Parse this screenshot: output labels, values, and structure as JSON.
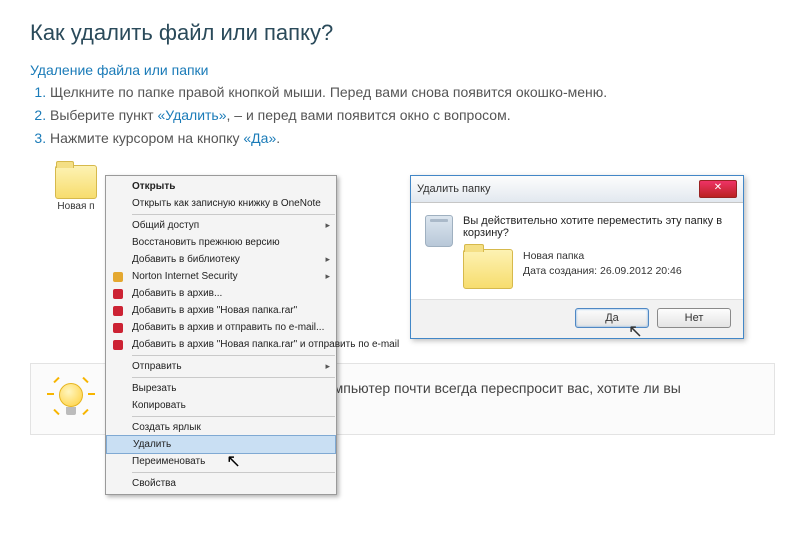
{
  "title": "Как удалить файл или папку?",
  "subtitle": "Удаление файла или папки",
  "steps": {
    "s1_a": "Щелкните по папке правой кнопкой мыши. Перед вами снова появится окошко-меню.",
    "s2_a": "Выберите пункт ",
    "s2_link": "«Удалить»",
    "s2_b": ", – и перед вами появится окно с вопросом.",
    "s3_a": "Нажмите курсором на кнопку ",
    "s3_link": "«Да»",
    "s3_b": "."
  },
  "folder_label": "Новая п",
  "context_menu": {
    "open": "Открыть",
    "onenote": "Открыть как записную книжку в OneNote",
    "share": "Общий доступ",
    "restore": "Восстановить прежнюю версию",
    "library": "Добавить в библиотеку",
    "norton": "Norton Internet Security",
    "arch1": "Добавить в архив...",
    "arch2": "Добавить в архив \"Новая папка.rar\"",
    "arch3": "Добавить в архив и отправить по e-mail...",
    "arch4": "Добавить в архив \"Новая папка.rar\" и отправить по e-mail",
    "send": "Отправить",
    "cut": "Вырезать",
    "copy": "Копировать",
    "shortcut": "Создать ярлык",
    "delete": "Удалить",
    "rename": "Переименовать",
    "props": "Свойства"
  },
  "dialog": {
    "title": "Удалить папку",
    "question": "Вы действительно хотите переместить эту папку в корзину?",
    "name": "Новая папка",
    "date": "Дата создания: 26.09.2012 20:46",
    "yes": "Да",
    "no": "Нет"
  },
  "tip": "Чтобы избежать случайностей, компьютер почти всегда переспросит вас, хотите ли вы совершить то или иное действие."
}
